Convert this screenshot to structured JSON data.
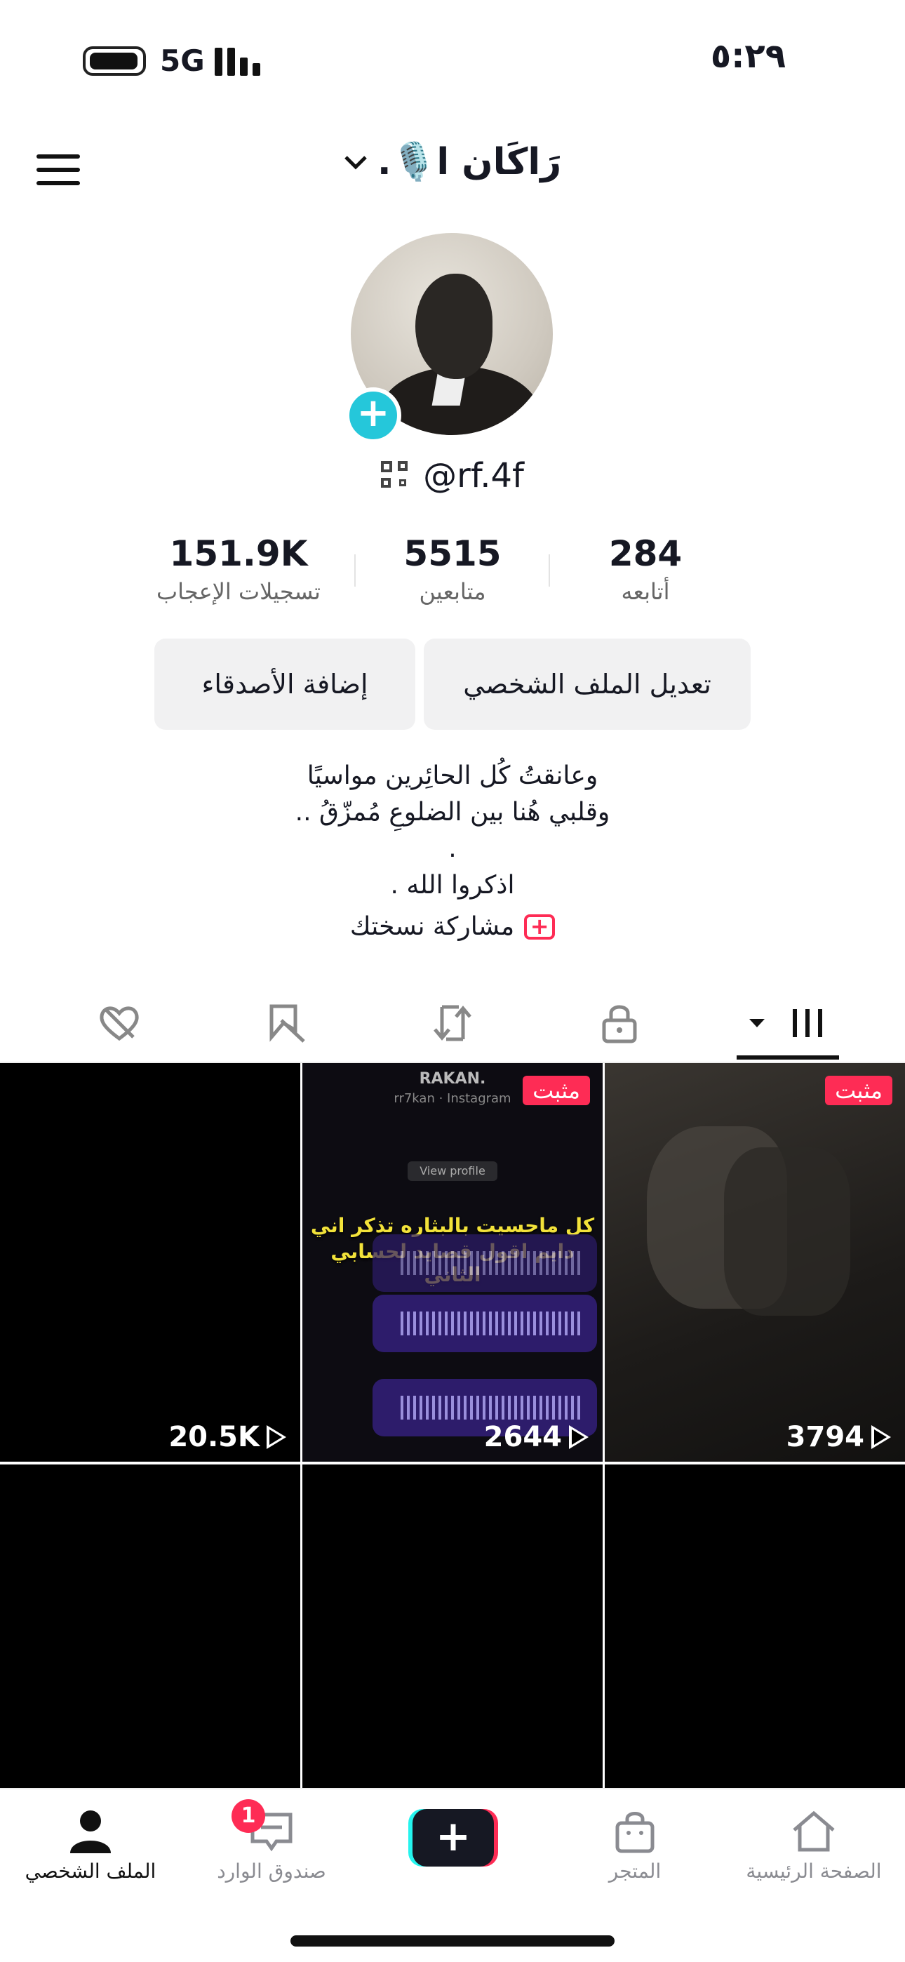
{
  "status_bar": {
    "time": "٥:٢٩",
    "network": "5G"
  },
  "header": {
    "title": "رَاكَان ا🎙️.",
    "chevron": "chevron-down-icon"
  },
  "profile": {
    "handle": "@rf.4f",
    "stats": [
      {
        "value": "151.9K",
        "label": "تسجيلات الإعجاب"
      },
      {
        "value": "5515",
        "label": "متابعين"
      },
      {
        "value": "284",
        "label": "أتابعه"
      }
    ],
    "buttons": {
      "add_friends": "إضافة الأصدقاء",
      "edit_profile": "تعديل الملف الشخصي"
    },
    "bio": [
      "وعانقتُ كُل الحائِرين مواسيًا",
      "وقلبي هُنا بين الضلوعِ مُمزّقُ ..",
      ".",
      "اذكروا الله ."
    ],
    "share_label": "مشاركة نسختك"
  },
  "tabs": [
    "liked-hidden",
    "favorites-hidden",
    "reposts",
    "private",
    "videos"
  ],
  "videos": [
    {
      "views": "3794",
      "pinned": "مثبت"
    },
    {
      "views": "2644",
      "pinned": "مثبت",
      "caption_line1": "كل ماحسيت بالبثاره تذكر اني",
      "caption_line2": "دايم اقول قصايد لحسابي الثاني",
      "header_name": "RAKAN.",
      "header_sub": "rr7kan · Instagram",
      "view_profile": "View profile"
    },
    {
      "views": "20.5K"
    },
    {},
    {},
    {}
  ],
  "bottom_nav": [
    {
      "label": "الصفحة الرئيسية"
    },
    {
      "label": "المتجر"
    },
    {
      "label": "+"
    },
    {
      "label": "صندوق الوارد",
      "badge": "1"
    },
    {
      "label": "الملف الشخصي"
    }
  ],
  "colors": {
    "accent": "#fe2c55",
    "cyan": "#25f4ee",
    "text": "#161823"
  }
}
